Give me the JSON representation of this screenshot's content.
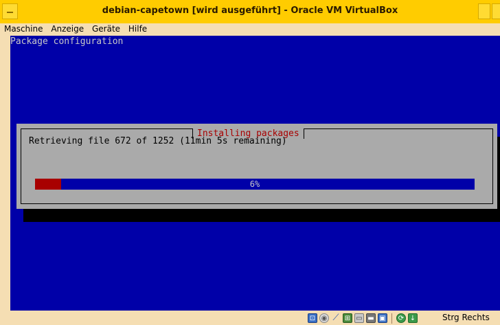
{
  "window": {
    "title": "debian-capetown [wird ausgeführt] - Oracle VM VirtualBox"
  },
  "menu": {
    "items": [
      "Maschine",
      "Anzeige",
      "Geräte",
      "Hilfe"
    ]
  },
  "guest": {
    "screen_title": "Package configuration",
    "dialog": {
      "title": "Installing packages",
      "message": "Retrieving file 672 of 1252 (11min 5s remaining)",
      "progress_percent": 6,
      "progress_label": "6%"
    },
    "colors": {
      "background": "#0000a8",
      "dialog": "#aaaaaa",
      "title_text": "#a80000",
      "progress_fill": "#a80000"
    }
  },
  "statusbar": {
    "icons": [
      "hard-disk-icon",
      "optical-drive-icon",
      "usb-icon",
      "network-icon",
      "shared-folders-icon",
      "display-icon",
      "video-capture-icon",
      "mouse-integration-icon",
      "keyboard-capture-icon"
    ],
    "host_key": "Strg Rechts"
  }
}
